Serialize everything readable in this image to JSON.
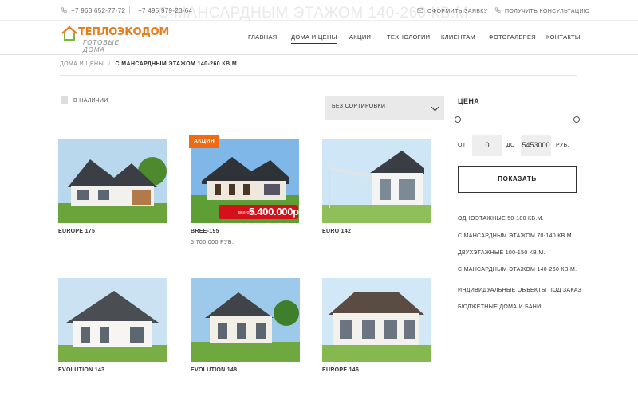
{
  "page": {
    "ghost_title": "С МАНСАРДНЫМ ЭТАЖОМ 140-260 КВ.М."
  },
  "topbar": {
    "phone1": "+7 963 652-77-72",
    "phone2": "+7 495 979-23-64",
    "link_request": "ОФОРМИТЬ ЗАЯВКУ",
    "link_consult": "ПОЛУЧИТЬ КОНСУЛЬТАЦИЮ"
  },
  "logo": {
    "main": "ТЕПЛОЭКОДОМ",
    "sub": "ГОТОВЫЕ ДОМА",
    "color": "#e97c1a"
  },
  "nav": {
    "items": [
      "ГЛАВНАЯ",
      "ДОМА И ЦЕНЫ",
      "АКЦИИ",
      "ТЕХНОЛОГИИ",
      "КЛИЕНТАМ",
      "ФОТОГАЛЕРЕЯ",
      "КОНТАКТЫ"
    ],
    "active": "ДОМА И ЦЕНЫ"
  },
  "breadcrumb": {
    "parent": "ДОМА И ЦЕНЫ",
    "separator": "/",
    "current": "С МАНСАРДНЫМ ЭТАЖОМ 140-260 КВ.М."
  },
  "filters": {
    "in_stock_label": "В НАЛИЧИИ",
    "sort_value": "БЕЗ СОРТИРОВКИ"
  },
  "products": [
    {
      "name": "EUROPE 175",
      "price": ""
    },
    {
      "name": "BREE-195",
      "price": "5 700 000 РУБ.",
      "badge": "АКЦИЯ",
      "promo_small": "всего за",
      "promo_big": "5.400.000р"
    },
    {
      "name": "EURO 142",
      "price": ""
    },
    {
      "name": "EVOLUTION 143",
      "price": ""
    },
    {
      "name": "EVOLUTION 148",
      "price": ""
    },
    {
      "name": "EUROPE 146",
      "price": ""
    }
  ],
  "price_filter": {
    "title": "ЦЕНА",
    "from_label": "ОТ",
    "from_value": "0",
    "to_label": "ДО",
    "to_value": "5453000",
    "currency": "РУБ.",
    "show_button": "ПОКАЗАТЬ"
  },
  "categories": [
    "ОДНОЭТАЖНЫЕ 50-180 КВ.М.",
    "С МАНСАРДНЫМ ЭТАЖОМ 70-140 КВ.М.",
    "ДВУХЭТАЖНЫЕ 100-150 КВ.М.",
    "С МАНСАРДНЫМ ЭТАЖОМ 140-260 КВ.М.",
    "ИНДИВИДУАЛЬНЫЕ ОБЪЕКТЫ ПОД ЗАКАЗ",
    "БЮДЖЕТНЫЕ ДОМА И БАНИ"
  ],
  "colors": {
    "accent": "#ef6a12",
    "promo_red": "#d4111b",
    "text": "#333333"
  }
}
